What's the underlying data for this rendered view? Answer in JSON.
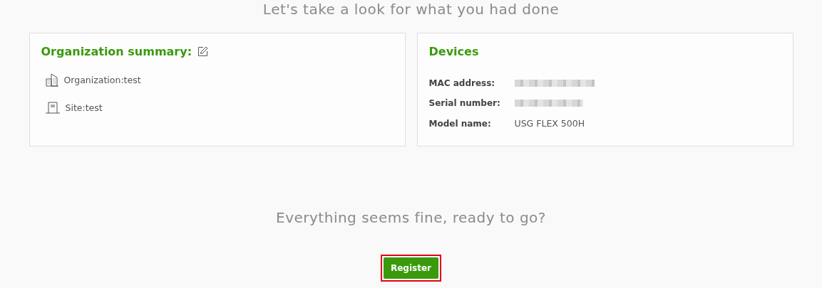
{
  "heading": "Let's take a look for what you had done",
  "organization_summary": {
    "title": "Organization summary:",
    "items": [
      {
        "kind": "building",
        "label": "Organization:test"
      },
      {
        "kind": "site",
        "label": "Site:test"
      }
    ]
  },
  "devices": {
    "title": "Devices",
    "rows": [
      {
        "label": "MAC address:",
        "kind": "redacted"
      },
      {
        "label": "Serial number:",
        "kind": "redacted"
      },
      {
        "label": "Model name:",
        "kind": "text",
        "value": "USG FLEX 500H"
      }
    ]
  },
  "prompt": "Everything seems fine, ready to go?",
  "register_button": {
    "label": "Register",
    "highlighted": true
  }
}
